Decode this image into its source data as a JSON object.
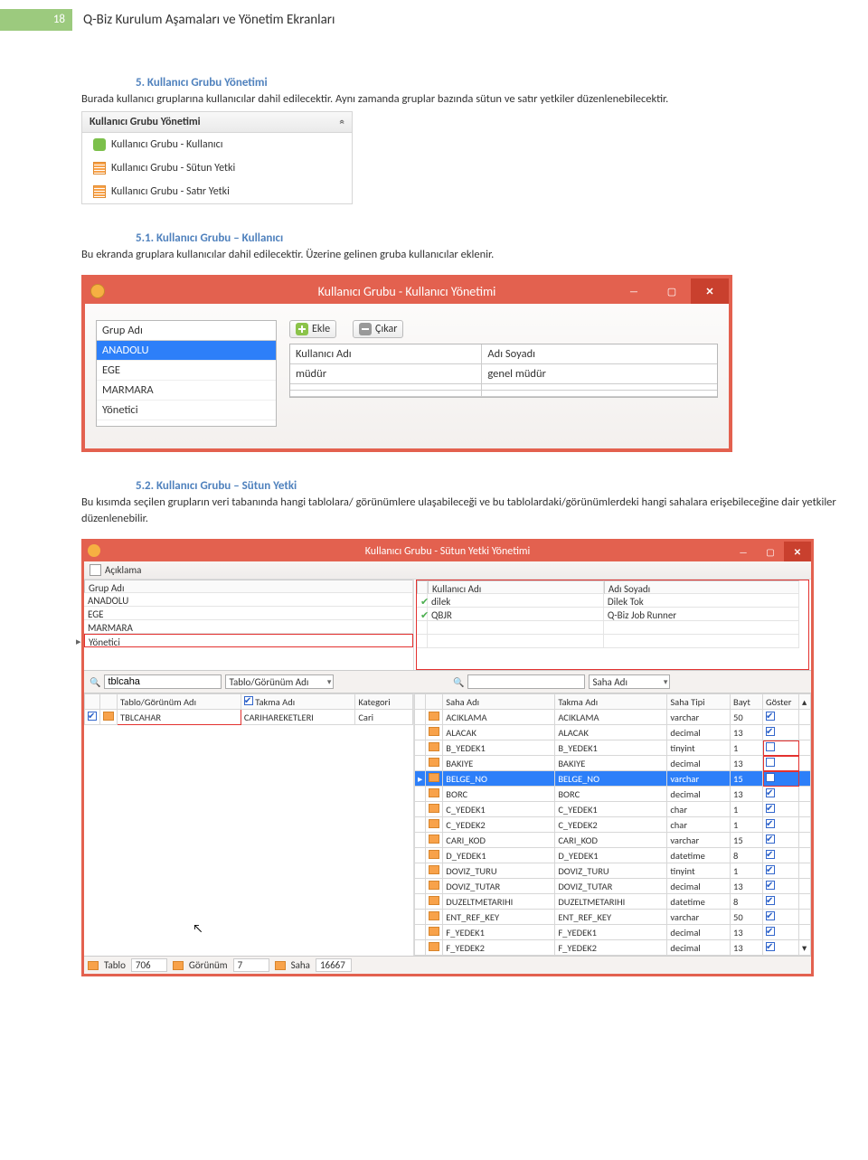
{
  "page": {
    "num": "18",
    "title": "Q-Biz Kurulum Aşamaları ve Yönetim Ekranları"
  },
  "h5": {
    "num": "5.",
    "txt": "Kullanıcı Grubu Yönetimi"
  },
  "p5": "Burada kullanıcı gruplarına kullanıcılar dahil edilecektir. Aynı zamanda gruplar bazında sütun ve satır yetkiler düzenlenebilecektir.",
  "nav": {
    "header": "Kullanıcı Grubu Yönetimi",
    "items": [
      {
        "label": "Kullanıcı Grubu - Kullanıcı"
      },
      {
        "label": "Kullanıcı Grubu - Sütun Yetki"
      },
      {
        "label": "Kullanıcı Grubu - Satır Yetki"
      }
    ]
  },
  "h51": {
    "num": "5.1.",
    "txt": "Kullanıcı Grubu – Kullanıcı"
  },
  "p51": "Bu ekranda gruplara kullanıcılar dahil edilecektir. Üzerine gelinen gruba kullanıcılar eklenir.",
  "win1": {
    "title": "Kullanıcı Grubu - Kullanıcı Yönetimi",
    "groups_header": "Grup Adı",
    "groups": [
      "ANADOLU",
      "EGE",
      "MARMARA",
      "Yönetici"
    ],
    "btn_add": "Ekle",
    "btn_remove": "Çıkar",
    "user_cols": [
      "Kullanıcı Adı",
      "Adı Soyadı"
    ],
    "user_rows": [
      [
        "müdür",
        "genel müdür"
      ]
    ]
  },
  "h52": {
    "num": "5.2.",
    "txt": "Kullanıcı Grubu – Sütun Yetki"
  },
  "p52": "Bu kısımda seçilen grupların veri tabanında hangi tablolara/ görünümlere ulaşabileceği ve bu tablolardaki/görünümlerdeki hangi sahalara erişebileceğine dair yetkiler düzenlenebilir.",
  "win2": {
    "title": "Kullanıcı Grubu - Sütun Yetki Yönetimi",
    "topbar": {
      "label": "Açıklama"
    },
    "top_left": {
      "header": "Grup Adı",
      "rows": [
        "ANADOLU",
        "EGE",
        "MARMARA",
        "Yönetici"
      ]
    },
    "top_right": {
      "cols": [
        "Kullanıcı Adı",
        "Adı Soyadı"
      ],
      "rows": [
        {
          "chk": true,
          "c1": "dilek",
          "c2": "Dilek Tok"
        },
        {
          "chk": true,
          "c1": "QBJR",
          "c2": "Q-Biz Job Runner"
        }
      ]
    },
    "search": {
      "left_value": "tblcaha",
      "left_combo": "Tablo/Görünüm Adı",
      "right_value": "",
      "right_combo": "Saha Adı"
    },
    "bl": {
      "cols": [
        "",
        "",
        "Tablo/Görünüm Adı",
        "Takma Adı",
        "Kategori"
      ],
      "row": {
        "chk": true,
        "name": "TBLCAHAR",
        "alias": "CARIHAREKETLERI",
        "cat": "Cari"
      }
    },
    "br": {
      "cols": [
        "",
        "",
        "Saha Adı",
        "Takma Adı",
        "Saha Tipi",
        "Bayt",
        "Göster"
      ],
      "rows": [
        {
          "name": "ACIKLAMA",
          "alias": "ACIKLAMA",
          "type": "varchar",
          "bayt": "50",
          "g": true
        },
        {
          "name": "ALACAK",
          "alias": "ALACAK",
          "type": "decimal",
          "bayt": "13",
          "g": true
        },
        {
          "name": "B_YEDEK1",
          "alias": "B_YEDEK1",
          "type": "tinyint",
          "bayt": "1",
          "g": false,
          "red": true
        },
        {
          "name": "BAKIYE",
          "alias": "BAKIYE",
          "type": "decimal",
          "bayt": "13",
          "g": false,
          "red": true
        },
        {
          "name": "BELGE_NO",
          "alias": "BELGE_NO",
          "type": "varchar",
          "bayt": "15",
          "g": false,
          "sel": true,
          "red": true
        },
        {
          "name": "BORC",
          "alias": "BORC",
          "type": "decimal",
          "bayt": "13",
          "g": true
        },
        {
          "name": "C_YEDEK1",
          "alias": "C_YEDEK1",
          "type": "char",
          "bayt": "1",
          "g": true
        },
        {
          "name": "C_YEDEK2",
          "alias": "C_YEDEK2",
          "type": "char",
          "bayt": "1",
          "g": true
        },
        {
          "name": "CARI_KOD",
          "alias": "CARI_KOD",
          "type": "varchar",
          "bayt": "15",
          "g": true
        },
        {
          "name": "D_YEDEK1",
          "alias": "D_YEDEK1",
          "type": "datetime",
          "bayt": "8",
          "g": true
        },
        {
          "name": "DOVIZ_TURU",
          "alias": "DOVIZ_TURU",
          "type": "tinyint",
          "bayt": "1",
          "g": true
        },
        {
          "name": "DOVIZ_TUTAR",
          "alias": "DOVIZ_TUTAR",
          "type": "decimal",
          "bayt": "13",
          "g": true
        },
        {
          "name": "DUZELTMETARIHI",
          "alias": "DUZELTMETARIHI",
          "type": "datetime",
          "bayt": "8",
          "g": true
        },
        {
          "name": "ENT_REF_KEY",
          "alias": "ENT_REF_KEY",
          "type": "varchar",
          "bayt": "50",
          "g": true
        },
        {
          "name": "F_YEDEK1",
          "alias": "F_YEDEK1",
          "type": "decimal",
          "bayt": "13",
          "g": true
        },
        {
          "name": "F_YEDEK2",
          "alias": "F_YEDEK2",
          "type": "decimal",
          "bayt": "13",
          "g": true
        }
      ]
    },
    "status": {
      "l1_lbl": "Tablo",
      "l1_val": "706",
      "l2_lbl": "Görünüm",
      "l2_val": "7",
      "l3_lbl": "Saha",
      "l3_val": "16667"
    }
  }
}
